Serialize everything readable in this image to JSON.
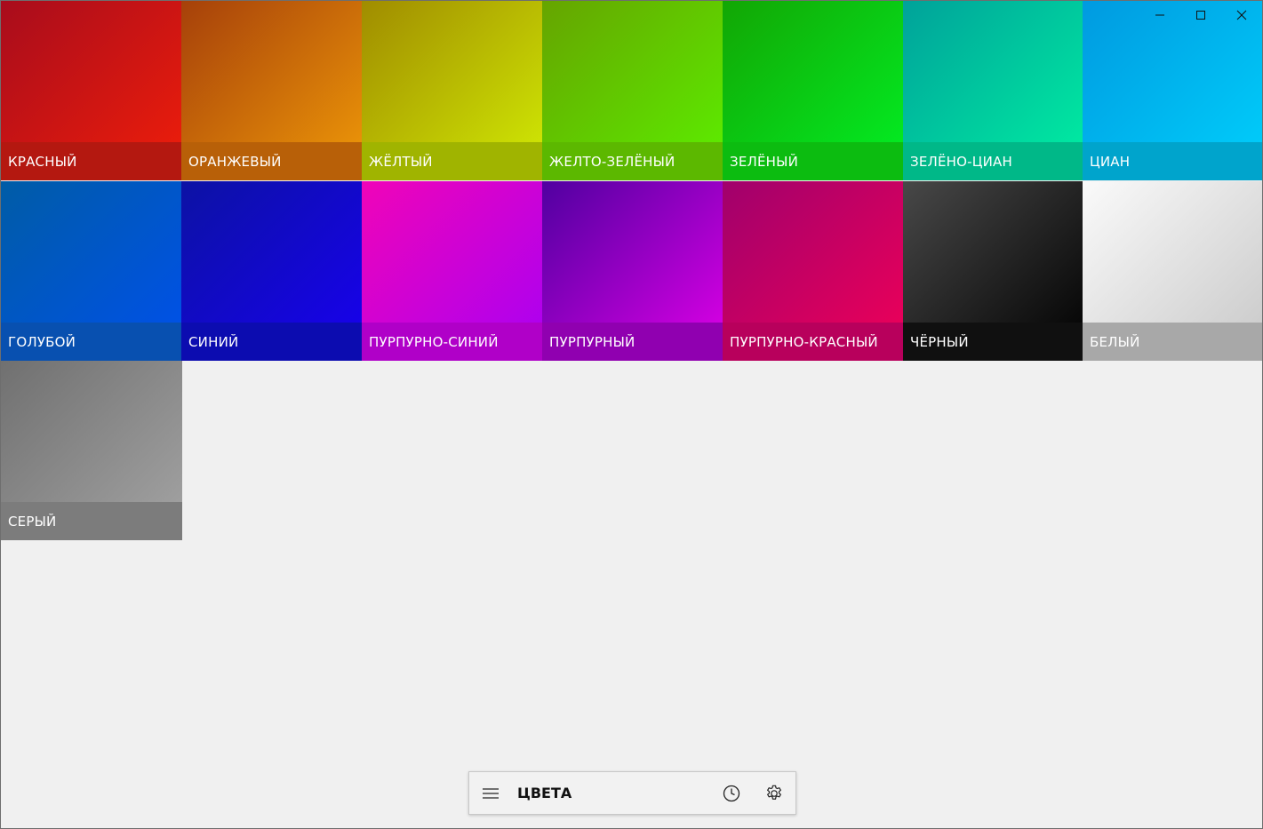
{
  "titlebar": {
    "minimize_icon": "minimize-icon",
    "maximize_icon": "maximize-icon",
    "close_icon": "close-icon"
  },
  "colors": [
    {
      "name": "КРАСНЫЙ",
      "from": "#a80c1c",
      "to": "#f01e0a",
      "bar": "#b41810"
    },
    {
      "name": "ОРАНЖЕВЫЙ",
      "from": "#a6400a",
      "to": "#f09a08",
      "bar": "#b86008"
    },
    {
      "name": "ЖЁЛТЫЙ",
      "from": "#a08c00",
      "to": "#d2ec04",
      "bar": "#a0b400"
    },
    {
      "name": "ЖЕЛТО-ЗЕЛЁНЫЙ",
      "from": "#66a400",
      "to": "#5cf000",
      "bar": "#5cb800"
    },
    {
      "name": "ЗЕЛЁНЫЙ",
      "from": "#12a604",
      "to": "#02f024",
      "bar": "#0cbc10"
    },
    {
      "name": "ЗЕЛЁНО-ЦИАН",
      "from": "#00a29a",
      "to": "#00f0a2",
      "bar": "#00b888"
    },
    {
      "name": "ЦИАН",
      "from": "#009ae0",
      "to": "#00d0fc",
      "bar": "#00a4cc"
    },
    {
      "name": "ГОЛУБОЙ",
      "from": "#005ca6",
      "to": "#0050ec",
      "bar": "#0850b0"
    },
    {
      "name": "СИНИЙ",
      "from": "#0c12a4",
      "to": "#1800f0",
      "bar": "#0c0cb0"
    },
    {
      "name": "ПУРПУРНО-СИНИЙ",
      "from": "#f004b8",
      "to": "#a800f4",
      "bar": "#b000c8"
    },
    {
      "name": "ПУРПУРНЫЙ",
      "from": "#5000a0",
      "to": "#e000e8",
      "bar": "#9000b0"
    },
    {
      "name": "ПУРПУРНО-КРАСНЫЙ",
      "from": "#a0006c",
      "to": "#f00058",
      "bar": "#b8005c"
    },
    {
      "name": "ЧЁРНЫЙ",
      "from": "#484848",
      "to": "#000000",
      "bar": "#101010"
    },
    {
      "name": "БЕЛЫЙ",
      "from": "#fafafa",
      "to": "#c8c8c8",
      "bar": "#a8a8a8"
    },
    {
      "name": "СЕРЫЙ",
      "from": "#707070",
      "to": "#a4a4a4",
      "bar": "#7c7c7c"
    }
  ],
  "toolbar": {
    "title": "ЦВЕТА",
    "menu_icon": "hamburger-menu-icon",
    "history_icon": "clock-icon",
    "settings_icon": "gear-icon"
  }
}
